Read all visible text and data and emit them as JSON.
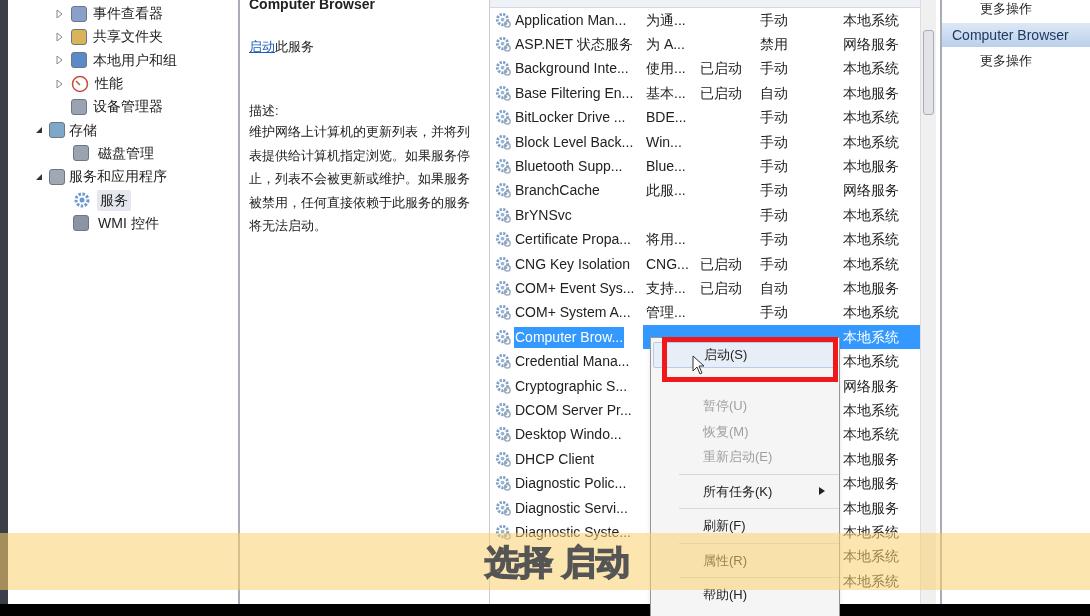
{
  "tree_upper": [
    {
      "label": "事件查看器",
      "kind": "event",
      "expanded": false
    },
    {
      "label": "共享文件夹",
      "kind": "share",
      "expanded": false
    },
    {
      "label": "本地用户和组",
      "kind": "users",
      "expanded": false
    },
    {
      "label": "性能",
      "kind": "perf",
      "expanded": false
    },
    {
      "label": "设备管理器",
      "kind": "device"
    }
  ],
  "tree": [
    {
      "label": "存储",
      "kind": "storage",
      "expanded": true,
      "children": [
        {
          "label": "磁盘管理",
          "kind": "disk",
          "selected": false
        }
      ]
    },
    {
      "label": "服务和应用程序",
      "kind": "apps",
      "expanded": true,
      "children": [
        {
          "label": "服务",
          "kind": "gear",
          "selected": true
        },
        {
          "label": "WMI 控件",
          "kind": "wmi",
          "selected": false
        }
      ]
    }
  ],
  "detail": {
    "heading": "Computer Browser",
    "link": "启动",
    "link_suffix": "此服务",
    "description_label": "描述:",
    "description": "维护网络上计算机的更新列表，并将列表提供给计算机指定浏览。如果服务停止，列表不会被更新或维护。如果服务被禁用，任何直接依赖于此服务的服务将无法启动。"
  },
  "services": [
    {
      "name": "Application Man...",
      "description": "为通...",
      "startup": "手动",
      "logon": "本地系统",
      "selected": false
    },
    {
      "name": "ASP.NET 状态服务",
      "description": "为 A...",
      "startup": "禁用",
      "logon": "网络服务",
      "selected": false
    },
    {
      "name": "Background Inte...",
      "description": "使用...",
      "status": "已启动",
      "startup": "手动",
      "logon": "本地系统",
      "selected": false
    },
    {
      "name": "Base Filtering En...",
      "description": "基本...",
      "status": "已启动",
      "startup": "自动",
      "logon": "本地服务",
      "selected": false
    },
    {
      "name": "BitLocker Drive ...",
      "description": "BDE...",
      "startup": "手动",
      "logon": "本地系统",
      "selected": false
    },
    {
      "name": "Block Level Back...",
      "description": "Win...",
      "startup": "手动",
      "logon": "本地系统",
      "selected": false
    },
    {
      "name": "Bluetooth Supp...",
      "description": "Blue...",
      "startup": "手动",
      "logon": "本地服务",
      "selected": false
    },
    {
      "name": "BranchCache",
      "description": "此服...",
      "startup": "手动",
      "logon": "网络服务",
      "selected": false
    },
    {
      "name": "BrYNSvc",
      "startup": "手动",
      "logon": "本地系统",
      "selected": false
    },
    {
      "name": "Certificate Propa...",
      "description": "将用...",
      "startup": "手动",
      "logon": "本地系统",
      "selected": false
    },
    {
      "name": "CNG Key Isolation",
      "description": "CNG...",
      "status": "已启动",
      "startup": "手动",
      "logon": "本地系统",
      "selected": false
    },
    {
      "name": "COM+ Event Sys...",
      "description": "支持...",
      "status": "已启动",
      "startup": "自动",
      "logon": "本地服务",
      "selected": false
    },
    {
      "name": "COM+ System A...",
      "description": "管理...",
      "startup": "手动",
      "logon": "本地系统",
      "selected": false
    },
    {
      "name": "Computer Brow...",
      "logon": "本地系统",
      "selected": true
    },
    {
      "name": "Credential Mana...",
      "logon": "本地系统",
      "selected": false
    },
    {
      "name": "Cryptographic S...",
      "logon": "网络服务",
      "selected": false
    },
    {
      "name": "DCOM Server Pr...",
      "logon": "本地系统",
      "selected": false
    },
    {
      "name": "Desktop Windo...",
      "logon": "本地系统",
      "selected": false
    },
    {
      "name": "DHCP Client",
      "logon": "本地服务",
      "selected": false
    },
    {
      "name": "Diagnostic Polic...",
      "logon": "本地服务",
      "selected": false
    },
    {
      "name": "Diagnostic Servi...",
      "logon": "本地服务",
      "selected": false
    },
    {
      "name": "Diagnostic Syste...",
      "logon": "本地系统",
      "selected": false
    },
    {
      "logon": "本地系统",
      "selected": false
    },
    {
      "logon": "本地系统",
      "selected": false
    }
  ],
  "context_menu": [
    {
      "kind": "item",
      "label": "启动(S)",
      "disabled": false,
      "selected": true
    },
    {
      "kind": "item",
      "selected": false
    },
    {
      "kind": "item",
      "label": "暂停(U)",
      "disabled": true,
      "selected": false
    },
    {
      "kind": "item",
      "label": "恢复(M)",
      "disabled": true,
      "selected": false
    },
    {
      "kind": "item",
      "label": "重新启动(E)",
      "disabled": true,
      "selected": false
    },
    {
      "kind": "separator"
    },
    {
      "kind": "submenu",
      "label": "所有任务(K)",
      "disabled": false,
      "selected": false
    },
    {
      "kind": "separator"
    },
    {
      "kind": "item",
      "label": "刷新(F)",
      "disabled": false,
      "selected": false
    },
    {
      "kind": "separator"
    },
    {
      "kind": "item",
      "label": "属性(R)",
      "disabled": false,
      "selected": false
    },
    {
      "kind": "separator"
    },
    {
      "kind": "item",
      "label": "帮助(H)",
      "disabled": false,
      "selected": false
    }
  ],
  "actions": {
    "top_link": "更多操作",
    "section": "Computer Browser",
    "section_link": "更多操作"
  },
  "caption": "选择 启动"
}
